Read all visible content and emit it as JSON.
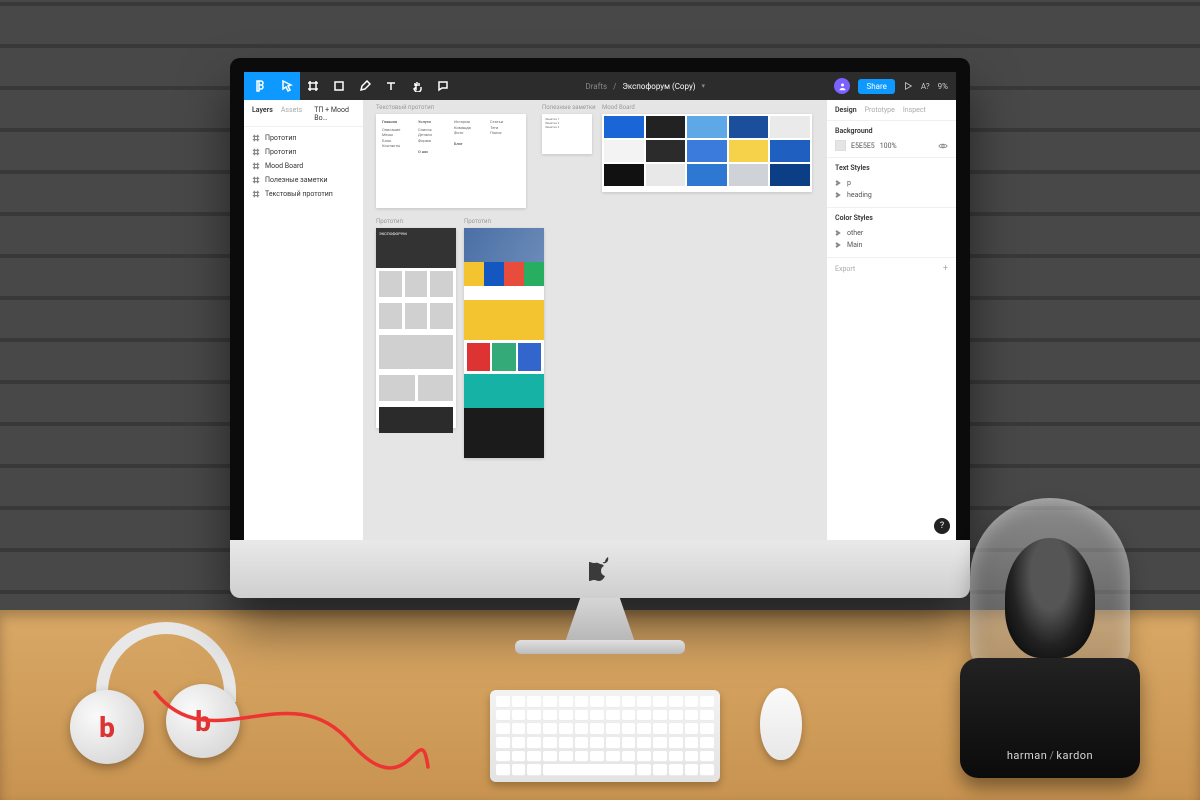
{
  "toolbar": {
    "breadcrumb": "Drafts",
    "filename": "Экспофорум (Copy)",
    "share_label": "Share",
    "view_label": "A?",
    "zoom": "9%"
  },
  "left_panel": {
    "tabs": {
      "layers": "Layers",
      "assets": "Assets"
    },
    "page_selector": "ТП + Mood Bo…",
    "layers": [
      {
        "name": "Прототип"
      },
      {
        "name": "Прототип"
      },
      {
        "name": "Mood Board"
      },
      {
        "name": "Полезные заметки"
      },
      {
        "name": "Текстовый прототип"
      }
    ]
  },
  "canvas": {
    "frames": {
      "text_proto": "Текстовый прототип",
      "notes": "Полезные заметки",
      "mood": "Mood Board",
      "proto_a": "Прототип",
      "proto_b": "Прототип"
    }
  },
  "right_panel": {
    "tabs": {
      "design": "Design",
      "prototype": "Prototype",
      "inspect": "Inspect"
    },
    "background": {
      "title": "Background",
      "hex": "E5E5E5",
      "opacity": "100%"
    },
    "text_styles": {
      "title": "Text Styles",
      "items": [
        "p",
        "heading"
      ]
    },
    "color_styles": {
      "title": "Color Styles",
      "items": [
        "other",
        "Main"
      ]
    },
    "export": {
      "title": "Export"
    }
  },
  "speaker_brand": {
    "a": "harman",
    "b": "kardon"
  }
}
